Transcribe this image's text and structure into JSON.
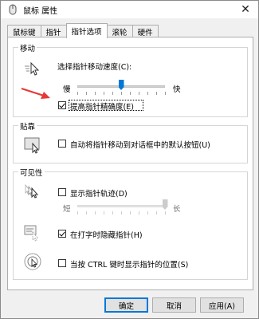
{
  "window": {
    "title": "鼠标 属性",
    "close_glyph": "✕"
  },
  "tabs": [
    {
      "label": "鼠标键"
    },
    {
      "label": "指针"
    },
    {
      "label": "指针选项"
    },
    {
      "label": "滚轮"
    },
    {
      "label": "硬件"
    }
  ],
  "motion": {
    "title": "移动",
    "speed_label": "选择指针移动速度(C):",
    "slow_label": "慢",
    "fast_label": "快",
    "speed_level": 0.5,
    "precision_label": "提高指针精确度(E)",
    "precision_checked": true
  },
  "snap": {
    "title": "贴靠",
    "label": "自动将指针移动到对话框中的默认按钮(U)",
    "checked": false
  },
  "visibility": {
    "title": "可见性",
    "trails_label": "显示指针轨迹(D)",
    "trails_checked": false,
    "short_label": "短",
    "long_label": "长",
    "trails_level": 1.0,
    "hide_label": "在打字时隐藏指针(H)",
    "hide_checked": true,
    "ctrl_label": "当按 CTRL 键时显示指针的位置(S)",
    "ctrl_checked": false
  },
  "buttons": {
    "ok": "确定",
    "cancel": "取消",
    "apply": "应用(A)"
  },
  "colors": {
    "accent": "#0078d7",
    "annotation_arrow": "#e53935"
  }
}
